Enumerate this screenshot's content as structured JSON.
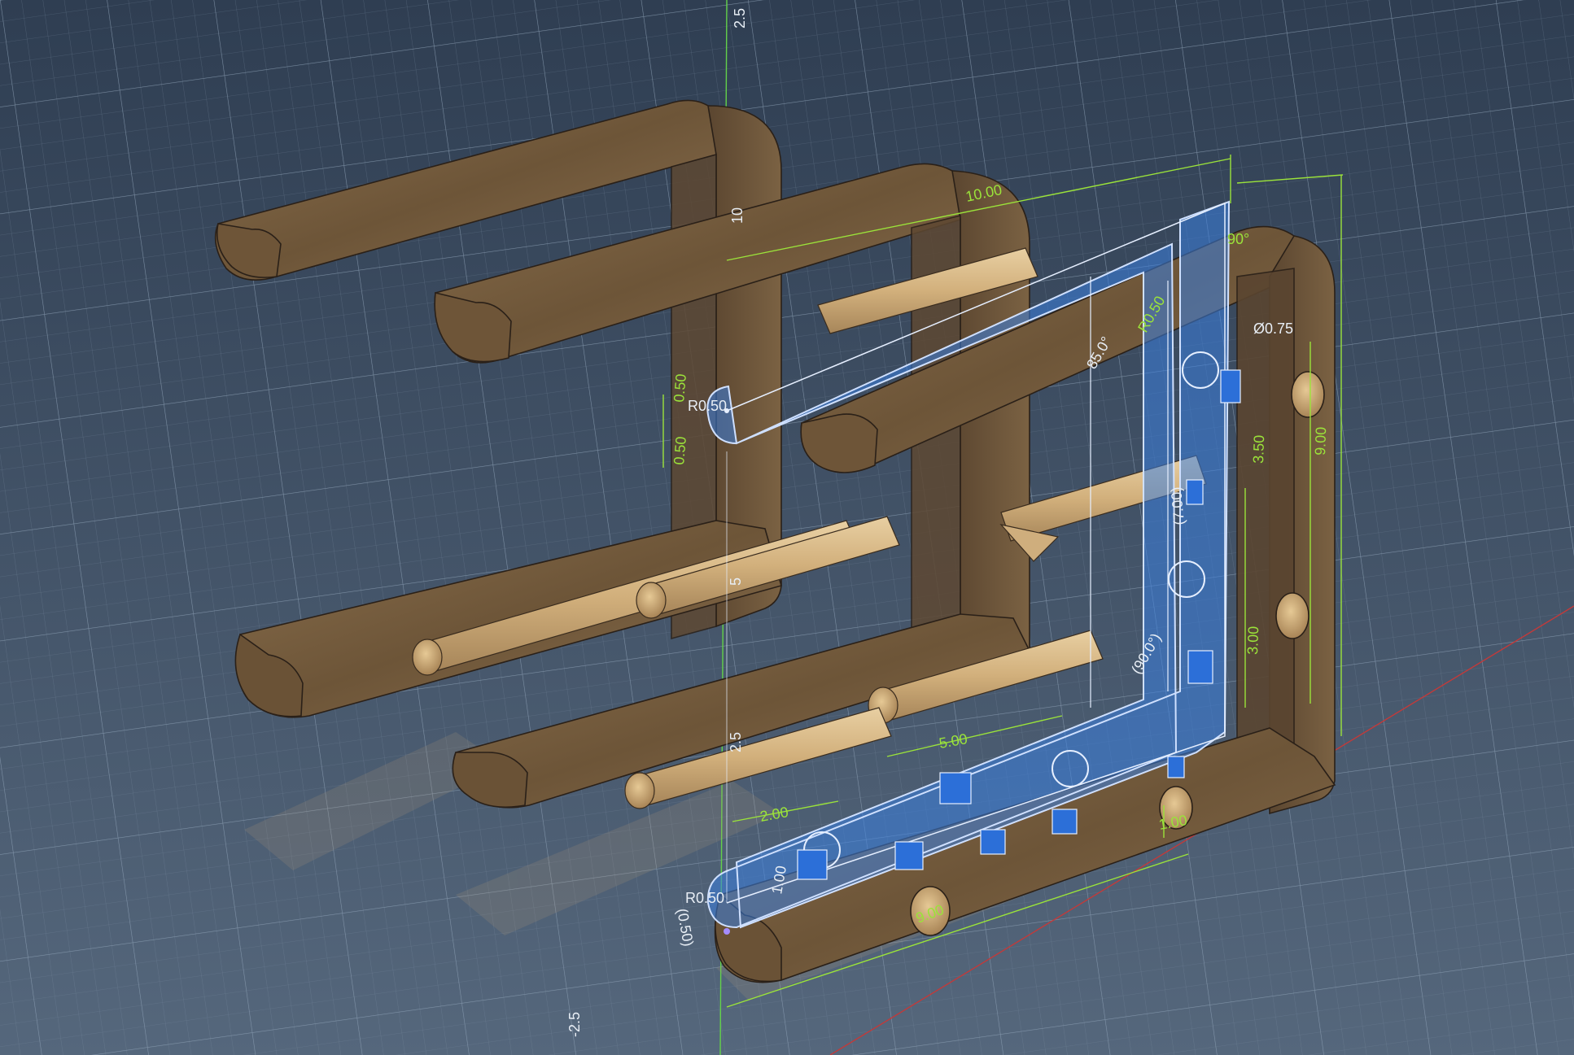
{
  "viewport": {
    "kind": "3d-cad-sketch-view"
  },
  "axis_labels": {
    "top": "2.5",
    "v10": "10",
    "v5": "5",
    "v25": "2.5",
    "neg": "-2.5"
  },
  "dimensions": {
    "top_width": "10.00",
    "right_height": "9.00",
    "bottom_width": "9.00",
    "diameter": "Ø0.75",
    "seg_350": "3.50",
    "seg_300": "3.00",
    "seg_500": "5.00",
    "seg_200": "2.00",
    "seg_100a": "1.00",
    "seg_100b": "1.00",
    "radius_top": "R0.50",
    "radius_bottom": "R0.50",
    "left_050a": "0.50",
    "left_050b": "0.50",
    "angle_850": "85.0°",
    "angle_90": "(90.0°)",
    "ref_700": "(7.00)",
    "ref_050": "(0.50)",
    "corner_angle": "90°",
    "r_mid": "R0.50"
  },
  "colors": {
    "background": "#3a4a5e",
    "grid": "#6e8299",
    "wood": "#7a6142",
    "sketch_fill": "#3b7fe0",
    "dimension": "#9be33a"
  }
}
